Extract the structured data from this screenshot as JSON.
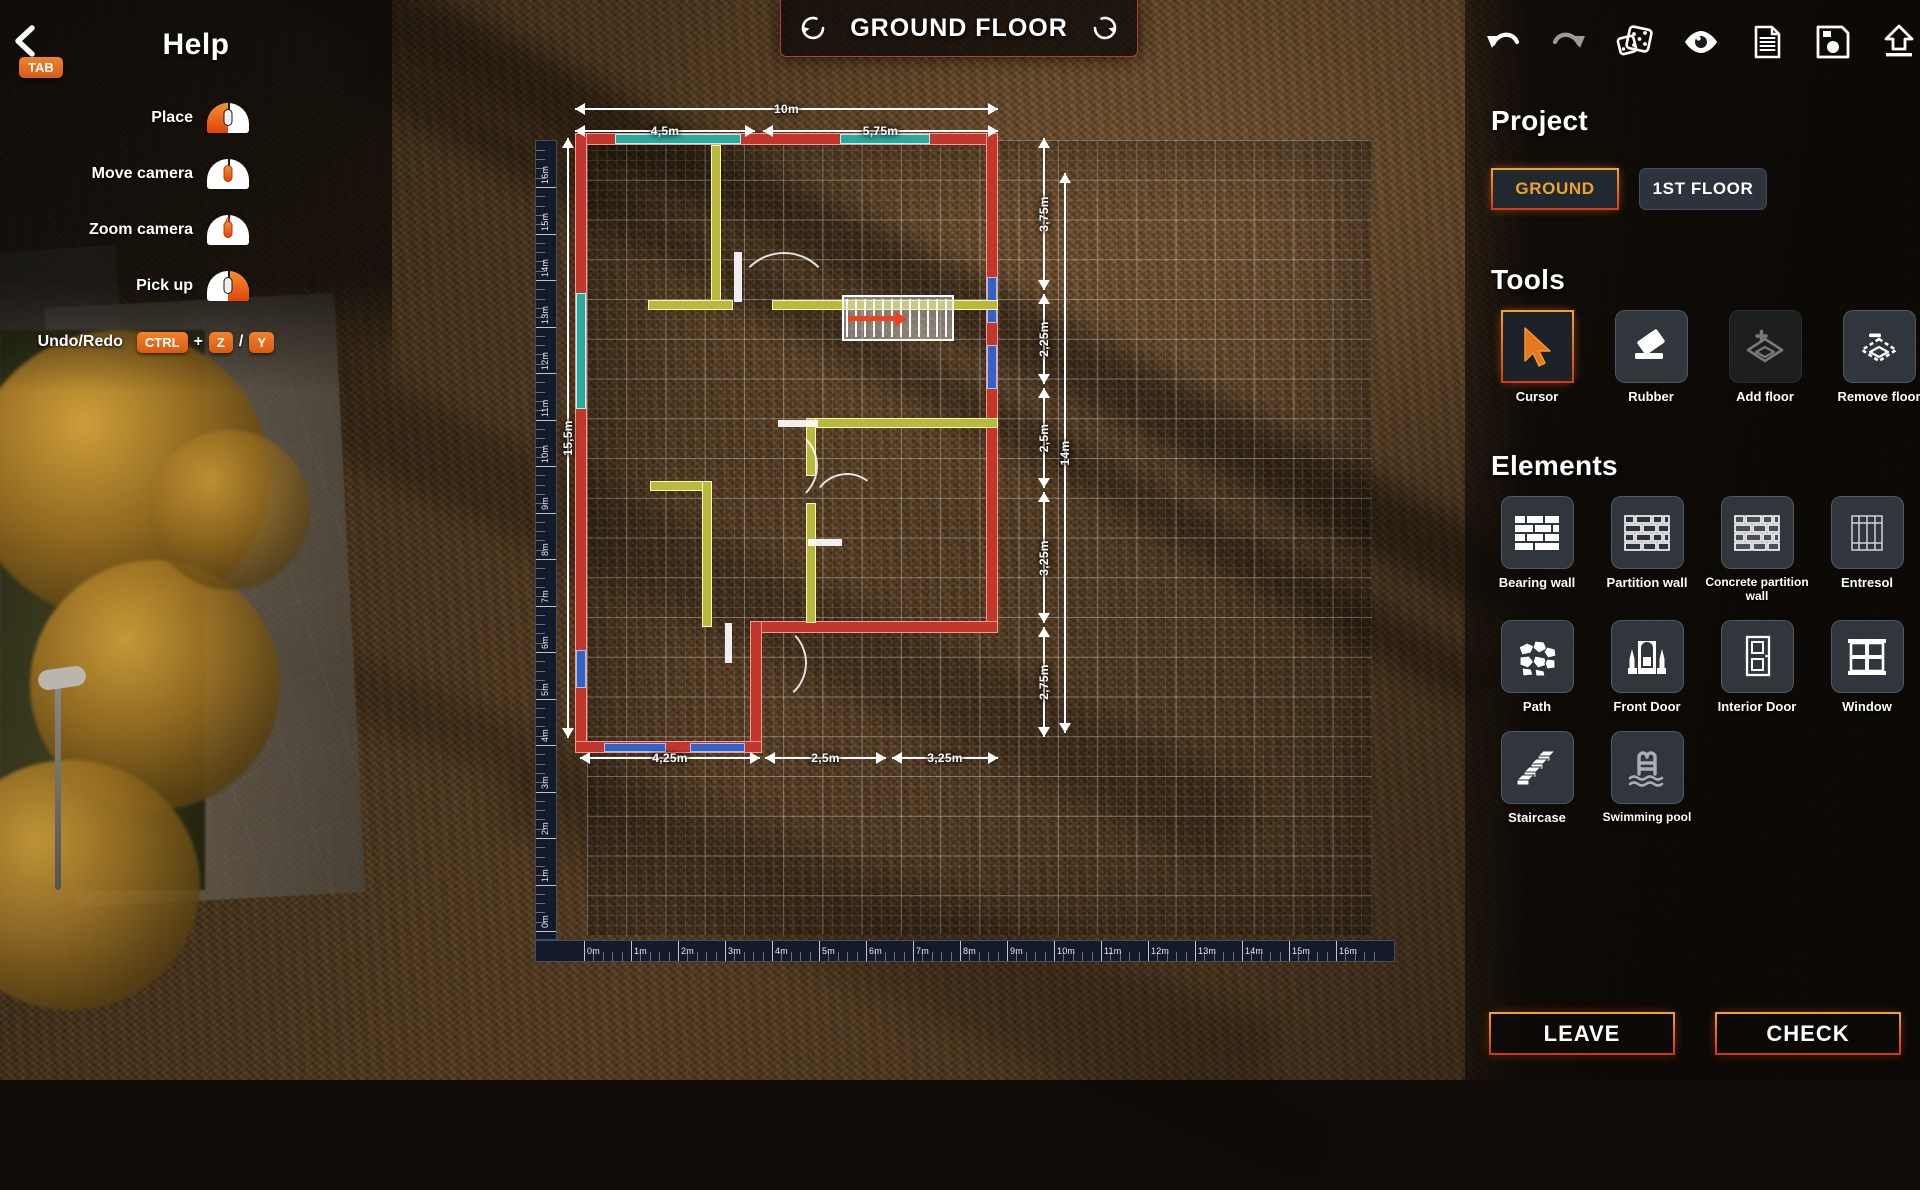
{
  "help": {
    "title": "Help",
    "back_key": "TAB",
    "rows": [
      {
        "label": "Place",
        "icon": "mouse-left-click-icon"
      },
      {
        "label": "Move camera",
        "icon": "mouse-wheel-press-icon"
      },
      {
        "label": "Zoom camera",
        "icon": "mouse-wheel-scroll-icon"
      },
      {
        "label": "Pick up",
        "icon": "mouse-right-click-icon"
      }
    ],
    "undo_redo": {
      "label": "Undo/Redo",
      "key1": "CTRL",
      "plus": "+",
      "key2": "Z",
      "slash": "/",
      "key3": "Y"
    }
  },
  "floor_title": {
    "text": "GROUND FLOOR",
    "rotate_left_icon": "rotate-ccw-icon",
    "rotate_right_icon": "rotate-cw-icon"
  },
  "toolbar": [
    {
      "name": "undo",
      "icon": "undo-arrow-icon",
      "state": "enabled"
    },
    {
      "name": "redo",
      "icon": "redo-arrow-icon",
      "state": "disabled"
    },
    {
      "name": "dice",
      "icon": "dice-icon",
      "state": "enabled"
    },
    {
      "name": "preview",
      "icon": "eye-icon",
      "state": "enabled"
    },
    {
      "name": "notes",
      "icon": "document-icon",
      "state": "enabled"
    },
    {
      "name": "save",
      "icon": "floppy-disk-icon",
      "state": "enabled"
    },
    {
      "name": "export",
      "icon": "upload-arrow-icon",
      "state": "enabled"
    }
  ],
  "project": {
    "title": "Project",
    "tabs": [
      {
        "label": "GROUND",
        "active": true
      },
      {
        "label": "1ST FLOOR",
        "active": false
      }
    ]
  },
  "tools": {
    "title": "Tools",
    "items": [
      {
        "label": "Cursor",
        "icon": "cursor-arrow-icon",
        "selected": true
      },
      {
        "label": "Rubber",
        "icon": "eraser-icon",
        "selected": false
      },
      {
        "label": "Add floor",
        "icon": "add-layer-icon",
        "selected": false,
        "disabled": true
      },
      {
        "label": "Remove floor",
        "icon": "remove-layer-icon",
        "selected": false
      }
    ]
  },
  "elements": {
    "title": "Elements",
    "items": [
      {
        "label": "Bearing wall",
        "icon": "solid-brick-wall-icon",
        "selected": false
      },
      {
        "label": "Partition wall",
        "icon": "brick-wall-icon",
        "selected": false
      },
      {
        "label": "Concrete partition wall",
        "icon": "concrete-wall-icon",
        "selected": false,
        "small": true
      },
      {
        "label": "Entresol",
        "icon": "entresol-icon",
        "selected": false
      },
      {
        "label": "Path",
        "icon": "stone-path-icon",
        "selected": false
      },
      {
        "label": "Front Door",
        "icon": "front-door-icon",
        "selected": false
      },
      {
        "label": "Interior Door",
        "icon": "interior-door-icon",
        "selected": false
      },
      {
        "label": "Window",
        "icon": "window-icon",
        "selected": false
      },
      {
        "label": "Staircase",
        "icon": "staircase-icon",
        "selected": false
      },
      {
        "label": "Swimming pool",
        "icon": "swimming-pool-icon",
        "selected": false,
        "small": true
      }
    ]
  },
  "footer": {
    "leave_label": "LEAVE",
    "check_label": "CHECK"
  },
  "plan": {
    "top_overall": "10m",
    "top_segments": [
      "4,5m",
      "5,75m"
    ],
    "bottom_segments": [
      "4,25m",
      "2,5m",
      "3,25m"
    ],
    "left_overall": "15,5m",
    "right_overall": "14m",
    "right_segments": [
      "3,75m",
      "2,25m",
      "2,5m",
      "3,25m",
      "2,75m"
    ],
    "ruler_bottom": [
      "0m",
      "1m",
      "2m",
      "3m",
      "4m",
      "5m",
      "6m",
      "7m",
      "8m",
      "9m",
      "10m",
      "11m",
      "12m",
      "13m",
      "14m",
      "15m",
      "16m"
    ],
    "ruler_left": [
      "0m",
      "1m",
      "2m",
      "3m",
      "4m",
      "5m",
      "6m",
      "7m",
      "8m",
      "9m",
      "10m",
      "11m",
      "12m",
      "13m",
      "14m",
      "15m",
      "16m"
    ],
    "legend_colors": {
      "bearing_wall": "#c2362c",
      "partition_wall": "#b9b83f",
      "window_teal": "#2fa79c",
      "window_blue": "#3560c4",
      "staircase": "#e1e1e4",
      "stair_direction_arrow": "#e8431c"
    },
    "accent_color": "#f0832b",
    "danger_color": "#cf3516"
  }
}
